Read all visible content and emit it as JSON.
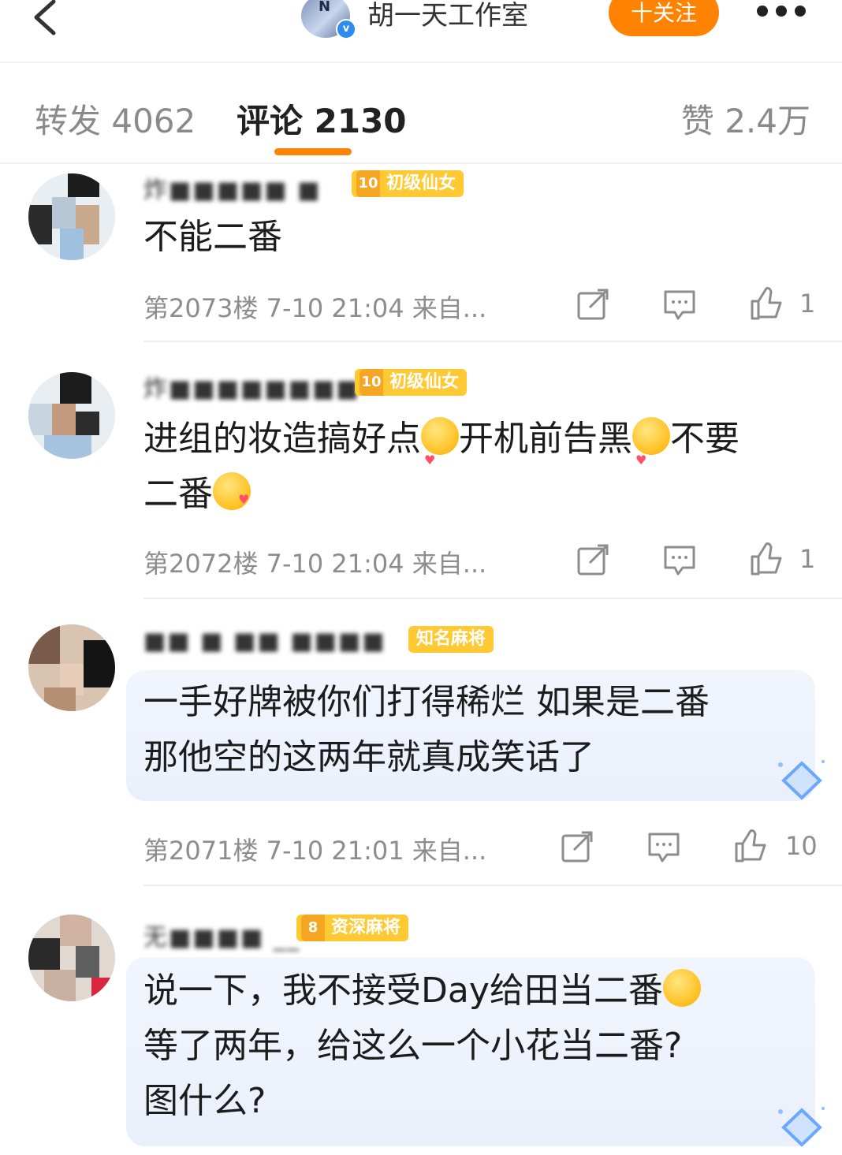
{
  "header": {
    "studio_name": "胡一天工作室",
    "follow_label": "十关注",
    "verified_mark": "v"
  },
  "tabs": {
    "repost": "转发 4062",
    "comment": "评论 2130",
    "like": "赞 2.4万"
  },
  "comments": [
    {
      "user": "炸■■■■■ ■",
      "badge_level": "10",
      "badge_text": "初级仙女",
      "text": "不能二番",
      "meta": "第2073楼 7-10 21:04 来自...",
      "likes": "1"
    },
    {
      "user": "炸■■■■■■■■",
      "badge_level": "10",
      "badge_text": "初级仙女",
      "text_parts": [
        "进组的妆造搞好点",
        "开机前告黑",
        "不要",
        "二番"
      ],
      "meta": "第2072楼 7-10 21:04 来自...",
      "likes": "1"
    },
    {
      "user": "■■ ■ ■■ ■■■■",
      "badge_text": "知名麻将",
      "text_lines": [
        "一手好牌被你们打得稀烂 如果是二番",
        "那他空的这两年就真成笑话了"
      ],
      "meta": "第2071楼 7-10 21:01 来自...",
      "likes": "10"
    },
    {
      "user": "无■■■■ __",
      "badge_level": "8",
      "badge_text": "资深麻将",
      "text_lines": [
        "说一下，我不接受Day给田当二番",
        "等了两年，给这么一个小花当二番?",
        "图什么?"
      ]
    }
  ],
  "icons": [
    "back-arrow-icon",
    "more-icon",
    "share-icon",
    "reply-icon",
    "thumbs-up-icon",
    "emoji-icon"
  ],
  "colors": {
    "accent": "#ff8200",
    "badge": "#ffc933",
    "muted": "#8d8d8d"
  }
}
